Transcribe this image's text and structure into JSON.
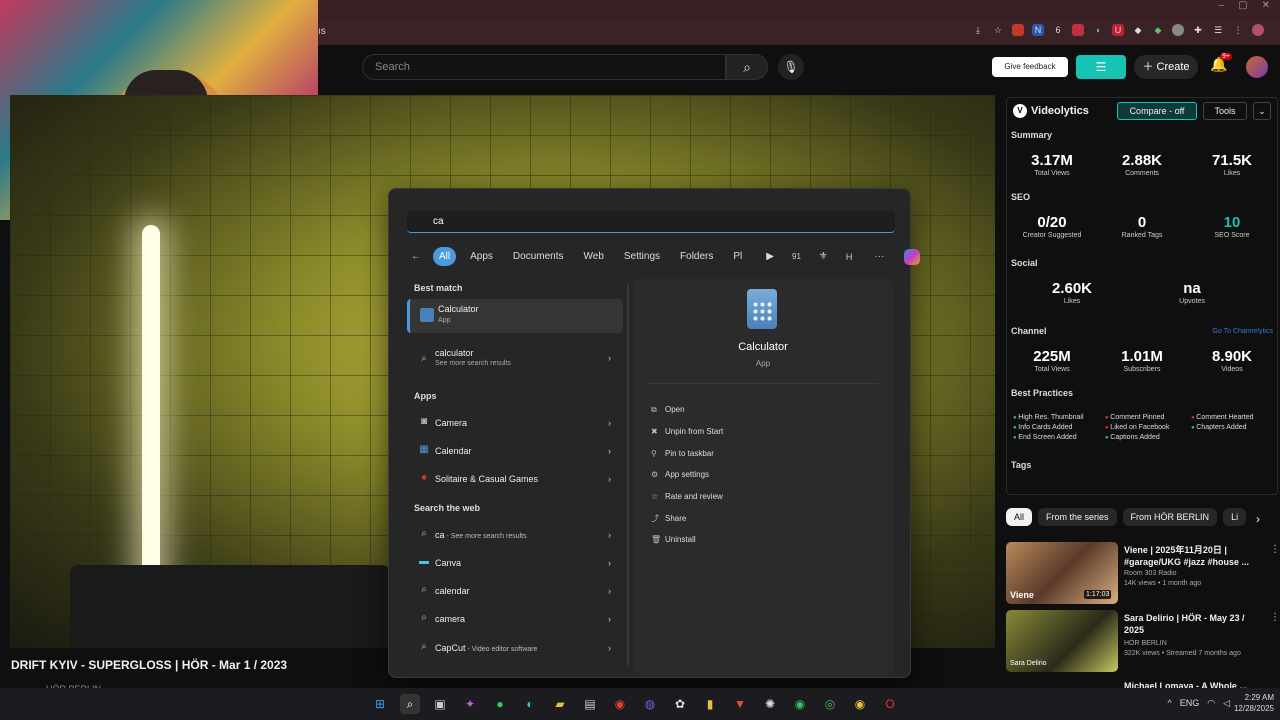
{
  "browser": {
    "url_fragment": "ıs",
    "extensions": [
      "youtube-ext-icon",
      "n-ext-icon",
      "b-ext-icon",
      "ext-icon",
      "mic-ext-icon",
      "u-ext-icon",
      "bookmark-ext-icon",
      "green-ext-icon",
      "gray-ext-icon",
      "puzzle-icon",
      "media-icon",
      "menu-icon",
      "profile-icon"
    ]
  },
  "youtube": {
    "search_placeholder": "Search",
    "feedback_label": "Give feedback",
    "create_label": "Create",
    "notifications_badge": "9+",
    "video_title": "DRIFT KYIV - SUPERGLOSS | HÖR - Mar 1 / 2023",
    "channel_fragment": "HÖR BERLIN"
  },
  "videolytics": {
    "title": "Videolytics",
    "compare_label": "Compare - off",
    "tools_label": "Tools",
    "summary": {
      "heading": "Summary",
      "stats": [
        {
          "value": "3.17M",
          "label": "Total Views"
        },
        {
          "value": "2.88K",
          "label": "Comments"
        },
        {
          "value": "71.5K",
          "label": "Likes"
        }
      ]
    },
    "seo": {
      "heading": "SEO",
      "stats": [
        {
          "value": "0/20",
          "label": "Creator Suggested"
        },
        {
          "value": "0",
          "label": "Ranked Tags"
        },
        {
          "value": "10",
          "label": "SEO Score"
        }
      ]
    },
    "social": {
      "heading": "Social",
      "stats": [
        {
          "value": "2.60K",
          "label": "Likes"
        },
        {
          "value": "na",
          "label": "Upvotes"
        }
      ]
    },
    "channel": {
      "heading": "Channel",
      "link": "Go To Channelytics",
      "stats": [
        {
          "value": "225M",
          "label": "Total Views"
        },
        {
          "value": "1.01M",
          "label": "Subscribers"
        },
        {
          "value": "8.90K",
          "label": "Videos"
        }
      ]
    },
    "best_practices": {
      "heading": "Best Practices",
      "items": [
        "High Res. Thumbnail",
        "Comment Pinned",
        "Comment Hearted",
        "Info Cards Added",
        "Liked on Facebook",
        "Chapters Added",
        "End Screen Added",
        "Captions Added"
      ]
    },
    "tags_heading": "Tags"
  },
  "chips": [
    "All",
    "From the series",
    "From HÖR BERLIN",
    "Li"
  ],
  "related": [
    {
      "title": "Viene | 2025年11月20日 | #garage/UKG #jazz #house ...",
      "channel": "Room 303 Radio",
      "meta": "14K views • 1 month ago",
      "duration": "1:17:03",
      "thumb_label": "Viene"
    },
    {
      "title": "Sara Delirio | HÖR - May 23 / 2025",
      "channel": "HÖR BERLIN",
      "meta": "322K views • Streamed 7 months ago",
      "duration": "",
      "thumb_label": "Sara Delirio"
    },
    {
      "title": "Michael Lomaya - A Whole ...",
      "channel": "",
      "meta": "",
      "duration": "",
      "thumb_label": ""
    }
  ],
  "start_menu": {
    "query": "ca",
    "tabs": [
      "All",
      "Apps",
      "Documents",
      "Web",
      "Settings",
      "Folders",
      "Pl"
    ],
    "tab_extras": [
      "91",
      "H"
    ],
    "best_match_heading": "Best match",
    "best_match": {
      "name": "Calculator",
      "type": "App"
    },
    "search_suggestion": {
      "text": "calculator",
      "sub": "See more search results"
    },
    "apps_heading": "Apps",
    "apps": [
      "Camera",
      "Calendar",
      "Solitaire & Casual Games"
    ],
    "web_heading": "Search the web",
    "web_results": [
      {
        "text": "ca",
        "sub": " - See more search results"
      },
      {
        "text": "Canva",
        "sub": ""
      },
      {
        "text": "calendar",
        "sub": ""
      },
      {
        "text": "camera",
        "sub": ""
      },
      {
        "text": "CapCut",
        "sub": " - Video editor software"
      }
    ],
    "detail": {
      "title": "Calculator",
      "subtitle": "App",
      "actions": [
        "Open",
        "Unpin from Start",
        "Pin to taskbar",
        "App settings",
        "Rate and review",
        "Share",
        "Uninstall"
      ]
    }
  },
  "taskbar": {
    "lang": "ENG",
    "time": "2:29 AM",
    "date": "12/28/2025"
  }
}
